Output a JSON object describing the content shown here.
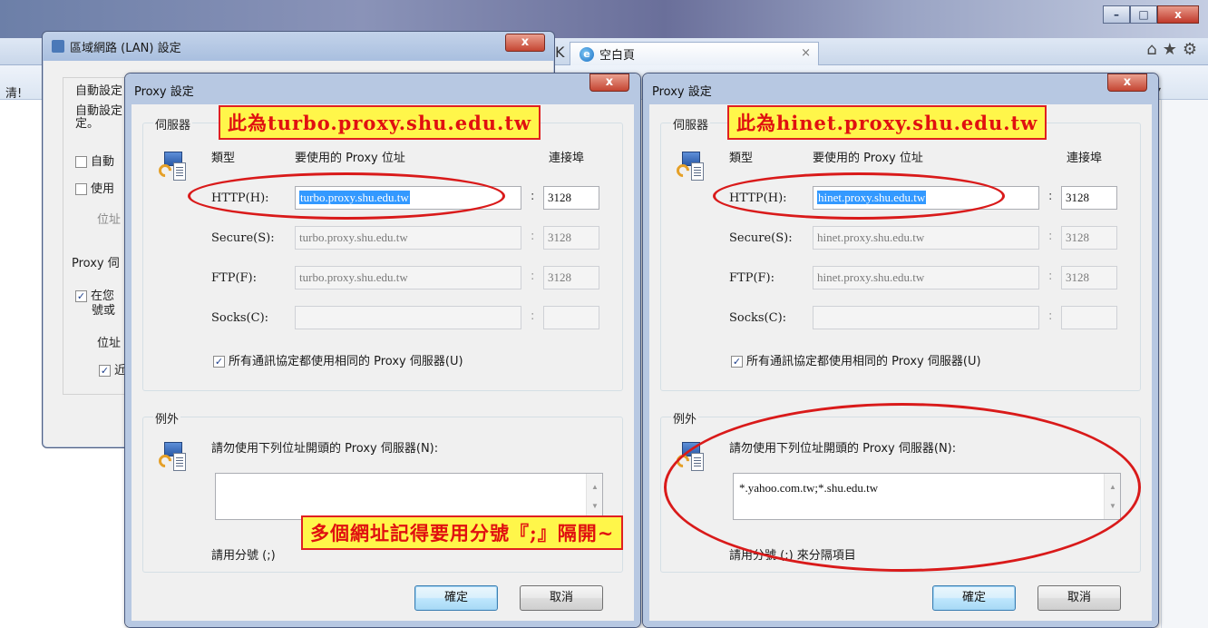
{
  "ie": {
    "tab_label": "空白頁",
    "tab_close": "×",
    "sidebar_text": "清!",
    "right_icons": "⌂★⚙",
    "win_min": "–",
    "win_max": "□",
    "win_close": "x",
    "left_arrow": "K"
  },
  "lan_dialog": {
    "title": "區域網路 (LAN) 設定",
    "close": "x",
    "auto_config_1": "自動設定",
    "auto_config_2a": "自動設定",
    "auto_config_2b": "定。",
    "auto_detect": "自動",
    "use_script": "使用",
    "address": "位址",
    "proxy_group": "Proxy 伺",
    "use_proxy_a": "在您",
    "use_proxy_b": "號或",
    "address2": "位址",
    "bypass": "近"
  },
  "proxy_left": {
    "title": "Proxy 設定",
    "close": "x",
    "servers_group": "伺服器",
    "col_type": "類型",
    "col_address": "要使用的 Proxy 位址",
    "col_port": "連接埠",
    "rows": [
      {
        "label": "HTTP(H):",
        "address": "turbo.proxy.shu.edu.tw",
        "port": "3128"
      },
      {
        "label": "Secure(S):",
        "address": "turbo.proxy.shu.edu.tw",
        "port": "3128"
      },
      {
        "label": "FTP(F):",
        "address": "turbo.proxy.shu.edu.tw",
        "port": "3128"
      },
      {
        "label": "Socks(C):",
        "address": "",
        "port": ""
      }
    ],
    "same_proxy": "所有通訊協定都使用相同的 Proxy 伺服器(U)",
    "exceptions_group": "例外",
    "exceptions_label": "請勿使用下列位址開頭的 Proxy 伺服器(N):",
    "exceptions_value": "",
    "separator_hint": "請用分號 (;)",
    "ok": "確定",
    "cancel": "取消"
  },
  "proxy_right": {
    "title": "Proxy 設定",
    "close": "x",
    "servers_group": "伺服器",
    "col_type": "類型",
    "col_address": "要使用的 Proxy 位址",
    "col_port": "連接埠",
    "rows": [
      {
        "label": "HTTP(H):",
        "address": "hinet.proxy.shu.edu.tw",
        "port": "3128"
      },
      {
        "label": "Secure(S):",
        "address": "hinet.proxy.shu.edu.tw",
        "port": "3128"
      },
      {
        "label": "FTP(F):",
        "address": "hinet.proxy.shu.edu.tw",
        "port": "3128"
      },
      {
        "label": "Socks(C):",
        "address": "",
        "port": ""
      }
    ],
    "same_proxy": "所有通訊協定都使用相同的 Proxy 伺服器(U)",
    "exceptions_group": "例外",
    "exceptions_label": "請勿使用下列位址開頭的 Proxy 伺服器(N):",
    "exceptions_value": "*.yahoo.com.tw;*.shu.edu.tw",
    "separator_hint": "請用分號 (;) 來分隔項目",
    "ok": "確定",
    "cancel": "取消"
  },
  "annotations": {
    "left_note": "此為turbo.proxy.shu.edu.tw",
    "right_note": "此為hinet.proxy.shu.edu.tw",
    "bottom_note": "多個網址記得要用分號『;』隔開~"
  },
  "colors": {
    "annotation_red": "#e01010",
    "annotation_yellow": "#fff64a",
    "selection_blue": "#3399ff"
  }
}
